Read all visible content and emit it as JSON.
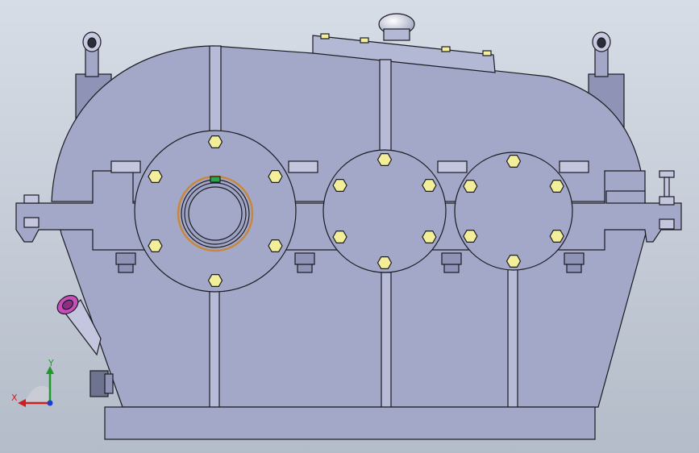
{
  "viewport": {
    "background_top": "#d7dde6",
    "background_bottom": "#b4bcc9"
  },
  "colors": {
    "housing": "#a3a8c8",
    "housing_dark": "#8f94b6",
    "outline": "#1b1b22",
    "bolt": "#f2ee9a",
    "bearing_ring": "#c8873a",
    "key_green": "#2ea44f",
    "magenta": "#c64fb9"
  },
  "triad": {
    "x_label": "X",
    "y_label": "Y",
    "x_axis_color": "#cc1f1f",
    "y_axis_color": "#1f9a2a",
    "z_axis_color": "#1a3fcf"
  },
  "icons": [
    "lifting-eye-icon",
    "breather-cap-icon",
    "oil-level-plug-icon",
    "drain-plug-icon"
  ]
}
